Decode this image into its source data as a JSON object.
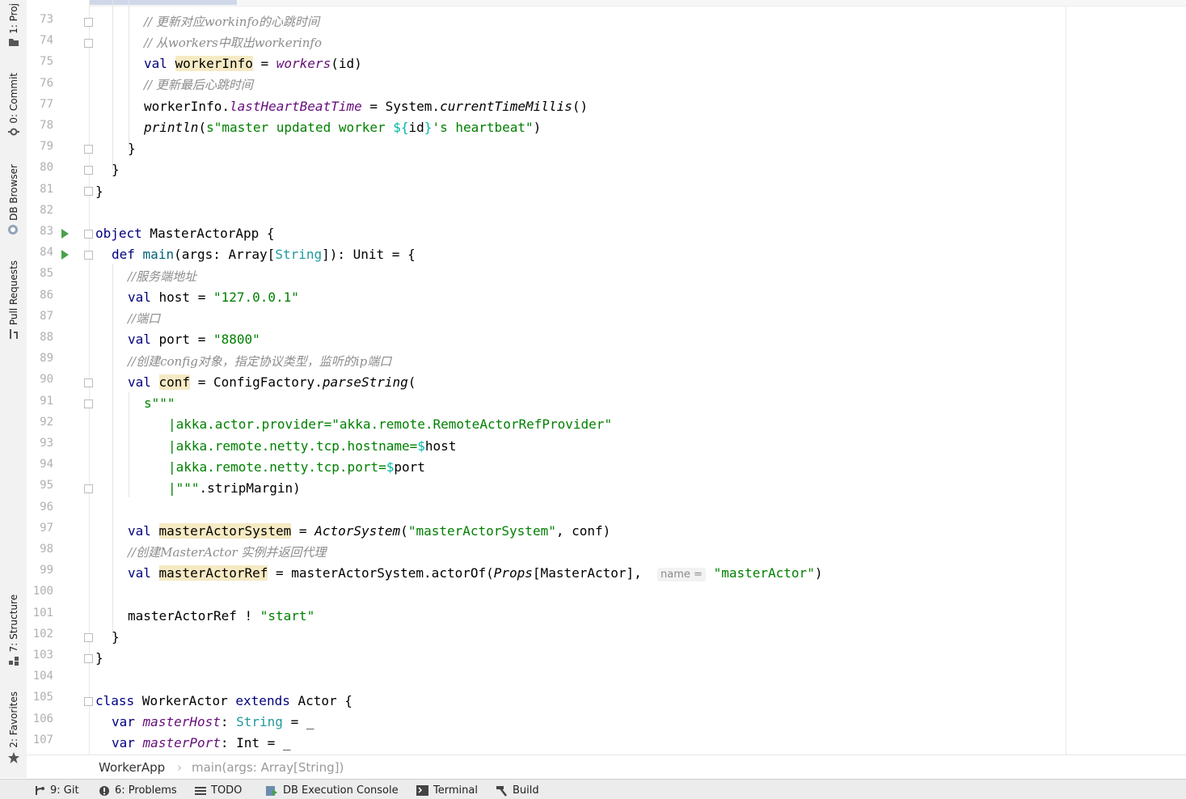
{
  "tool_windows_left": [
    {
      "label": "1: Proj",
      "icon": "folder-icon"
    },
    {
      "label": "0: Commit",
      "icon": "commit-icon"
    },
    {
      "label": "DB Browser",
      "icon": "db-browser-icon"
    },
    {
      "label": "Pull Requests",
      "icon": "pull-request-icon"
    },
    {
      "label": "7: Structure",
      "icon": "structure-icon"
    },
    {
      "label": "2: Favorites",
      "icon": "star-icon"
    }
  ],
  "line_numbers": [
    "73",
    "74",
    "75",
    "76",
    "77",
    "78",
    "79",
    "80",
    "81",
    "82",
    "83",
    "84",
    "85",
    "86",
    "87",
    "88",
    "89",
    "90",
    "91",
    "92",
    "93",
    "94",
    "95",
    "96",
    "97",
    "98",
    "99",
    "100",
    "101",
    "102",
    "103",
    "104",
    "105",
    "106",
    "107"
  ],
  "code": {
    "l73": "// 更新对应workinfo的心跳时间",
    "l74": "// 从workers中取出workerinfo",
    "l75_kw": "val ",
    "l75_var": "workerInfo",
    "l75_eq": " = ",
    "l75_fn": "workers",
    "l75_rest": "(id)",
    "l76": "// 更新最后心跳时间",
    "l77_a": "workerInfo.",
    "l77_field": "lastHeartBeatTime",
    "l77_b": " = System.",
    "l77_fn": "currentTimeMillis",
    "l77_c": "()",
    "l78_fn": "println",
    "l78_a": "(",
    "l78_s1": "s\"master updated worker ",
    "l78_d": "${",
    "l78_id": "id",
    "l78_e": "}",
    "l78_s2": "'s heartbeat\"",
    "l78_b": ")",
    "l79": "}",
    "l80": "}",
    "l81": "}",
    "l83_kw": "object",
    "l83_rest": " MasterActorApp {",
    "l84_kw": "def",
    "l84_a": " ",
    "l84_name": "main",
    "l84_b": "(args: Array[",
    "l84_type": "String",
    "l84_c": "]): Unit = {",
    "l85": "//服务端地址",
    "l86_kw": "val ",
    "l86_a": "host = ",
    "l86_s": "\"127.0.0.1\"",
    "l87": "//端口",
    "l88_kw": "val ",
    "l88_a": "port = ",
    "l88_s": "\"8800\"",
    "l89": "//创建config对象，指定协议类型，监听的ip端口",
    "l90_kw": "val ",
    "l90_var": "conf",
    "l90_a": " = ConfigFactory.",
    "l90_fn": "parseString",
    "l90_b": "(",
    "l91": "s\"\"\"",
    "l92": "|akka.actor.provider=\"akka.remote.RemoteActorRefProvider\"",
    "l93_s": "|akka.remote.netty.tcp.hostname=",
    "l93_d": "$",
    "l93_v": "host",
    "l94_s": "|akka.remote.netty.tcp.port=",
    "l94_d": "$",
    "l94_v": "port",
    "l95_s": "|\"\"\"",
    "l95_rest": ".stripMargin)",
    "l97_kw": "val ",
    "l97_var": "masterActorSystem",
    "l97_a": " = ",
    "l97_fn": "ActorSystem",
    "l97_b": "(",
    "l97_s": "\"masterActorSystem\"",
    "l97_c": ", conf)",
    "l98": "//创建MasterActor 实例并返回代理",
    "l99_kw": "val ",
    "l99_var": "masterActorRef",
    "l99_a": " = masterActorSystem.actorOf(",
    "l99_fn": "Props",
    "l99_b": "[MasterActor],  ",
    "l99_hint": "name =",
    "l99_c": " ",
    "l99_s": "\"masterActor\"",
    "l99_d": ")",
    "l101_a": "masterActorRef ! ",
    "l101_s": "\"start\"",
    "l102": "}",
    "l103": "}",
    "l105_kw": "class",
    "l105_a": " WorkerActor ",
    "l105_kw2": "extends",
    "l105_b": " Actor {",
    "l106_kw": "var",
    "l106_a": " ",
    "l106_field": "masterHost",
    "l106_b": ": ",
    "l106_type": "String",
    "l106_c": " = _",
    "l107_kw": "var",
    "l107_a": " ",
    "l107_field": "masterPort",
    "l107_b": ": Int = _"
  },
  "breadcrumb": {
    "class": "WorkerApp",
    "separator": "›",
    "method": "main(args: Array[String])"
  },
  "status_tabs": [
    {
      "label": "9: Git",
      "icon": "git-icon"
    },
    {
      "label": "6: Problems",
      "icon": "problems-icon"
    },
    {
      "label": "TODO",
      "icon": "todo-icon"
    },
    {
      "label": "DB Execution Console",
      "icon": "db-console-icon"
    },
    {
      "label": "Terminal",
      "icon": "terminal-icon"
    },
    {
      "label": "Build",
      "icon": "hammer-icon"
    }
  ],
  "colors": {
    "keyword": "#000080",
    "string": "#008000",
    "comment": "#8c8c8c",
    "field": "#660e7a",
    "type": "#20999d",
    "highlight": "#f6eac4",
    "run": "#4aa14a"
  }
}
